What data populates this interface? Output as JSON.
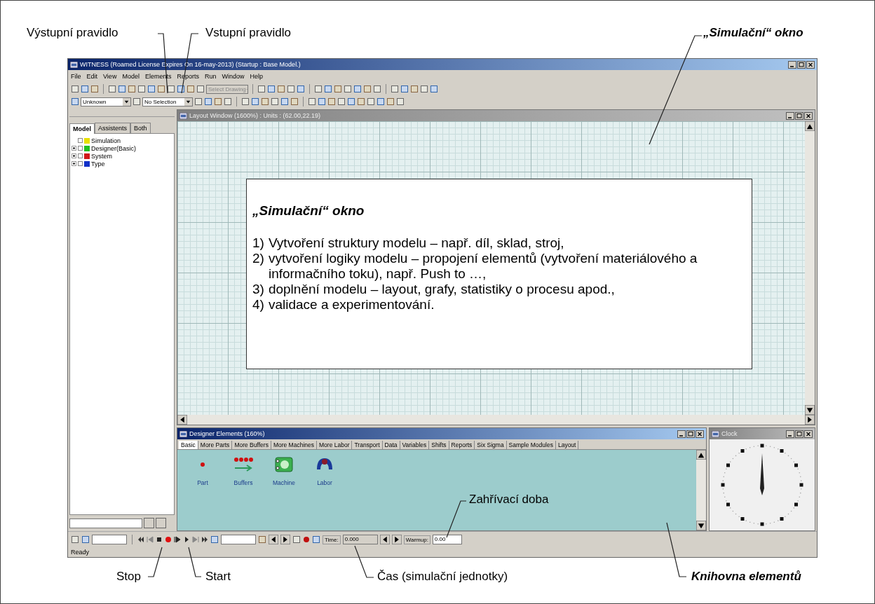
{
  "callouts": [
    {
      "text": "Výstupní pravidlo",
      "emphasis": false
    },
    {
      "text": "Vstupní pravidlo",
      "emphasis": false
    },
    {
      "text": "„Simulační“ okno",
      "emphasis": true
    },
    {
      "text": "Zahřívací doba",
      "emphasis": false
    },
    {
      "text": "Stop",
      "emphasis": false
    },
    {
      "text": "Start",
      "emphasis": false
    },
    {
      "text": "Čas (simulační jednotky)",
      "emphasis": false
    },
    {
      "text": "Knihovna elementů",
      "emphasis": true
    }
  ],
  "window": {
    "title": "WITNESS (Roamed License Expires On 16-may-2013) (Startup : Base Model.)"
  },
  "menu": [
    "File",
    "Edit",
    "View",
    "Model",
    "Elements",
    "Reports",
    "Run",
    "Window",
    "Help"
  ],
  "toolbar": {
    "drawing_select": "Select Drawing",
    "type_select": "Unknown",
    "selection_select": "No Selection"
  },
  "model_panel": {
    "tabs": [
      {
        "label": "Model",
        "selected": true
      },
      {
        "label": "Assistents",
        "selected": false
      },
      {
        "label": "Both",
        "selected": false
      }
    ],
    "tree": [
      {
        "label": "Simulation",
        "color": "#e8e000",
        "expandable": false,
        "checked": false
      },
      {
        "label": "Designer(Basic)",
        "color": "#20c020",
        "expandable": true,
        "checked": false
      },
      {
        "label": "System",
        "color": "#d01818",
        "expandable": true,
        "checked": false
      },
      {
        "label": "Type",
        "color": "#1030c8",
        "expandable": true,
        "checked": false
      }
    ]
  },
  "layout_window": {
    "title": "Layout Window (1600%) : Units : (62.00,22.19)"
  },
  "note": {
    "title": "„Simulační“ okno",
    "items": [
      {
        "number": "1)",
        "text": "Vytvoření struktury modelu – např. díl, sklad, stroj,"
      },
      {
        "number": "2)",
        "text": "vytvoření logiky modelu – propojení elementů (vytvoření materiálového a informačního toku), např. Push to …,"
      },
      {
        "number": "3)",
        "text": "doplnění modelu – layout, grafy, statistiky o procesu apod.,"
      },
      {
        "number": "4)",
        "text": "validace a experimentování."
      }
    ]
  },
  "designer": {
    "title": "Designer Elements (160%)",
    "tabs": [
      {
        "label": "Basic",
        "selected": true
      },
      {
        "label": "More Parts",
        "selected": false
      },
      {
        "label": "More Buffers",
        "selected": false
      },
      {
        "label": "More Machines",
        "selected": false
      },
      {
        "label": "More Labor",
        "selected": false
      },
      {
        "label": "Transport",
        "selected": false
      },
      {
        "label": "Data",
        "selected": false
      },
      {
        "label": "Variables",
        "selected": false
      },
      {
        "label": "Shifts",
        "selected": false
      },
      {
        "label": "Reports",
        "selected": false
      },
      {
        "label": "Six Sigma",
        "selected": false
      },
      {
        "label": "Sample Modules",
        "selected": false
      },
      {
        "label": "Layout",
        "selected": false
      }
    ],
    "elements": [
      {
        "label": "Part",
        "kind": "part"
      },
      {
        "label": "Buffers",
        "kind": "buffer"
      },
      {
        "label": "Machine",
        "kind": "machine"
      },
      {
        "label": "Labor",
        "kind": "labor"
      }
    ]
  },
  "clock": {
    "title": "Clock"
  },
  "run_bar": {
    "time_label": "Time:",
    "time": "0.000",
    "warmup_label": "Warmup:",
    "warmup": "0.00"
  },
  "status": "Ready"
}
